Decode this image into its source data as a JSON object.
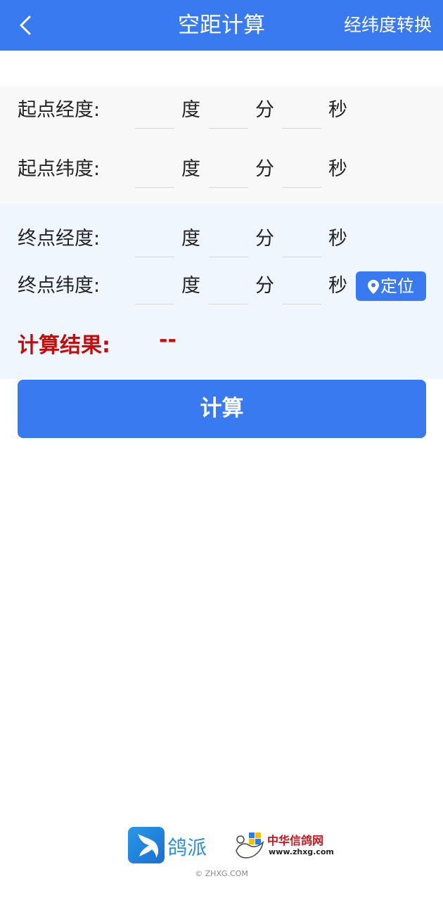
{
  "header": {
    "title": "空距计算",
    "link": "经纬度转换",
    "color": "#3a7af0"
  },
  "units": {
    "degree": "度",
    "minute": "分",
    "second": "秒"
  },
  "start": {
    "longitude_label": "起点经度:",
    "latitude_label": "起点纬度:"
  },
  "end": {
    "longitude_label": "终点经度:",
    "latitude_label": "终点纬度:",
    "locate_label": "定位"
  },
  "result": {
    "label": "计算结果:",
    "value": "--",
    "color": "#c30d0d"
  },
  "calculate_button": "计算",
  "footer": {
    "logo_pigeonpai": "鸽派",
    "logo_zhxg": "中华信鸽网",
    "logo_zhxg_url": "www.zhxg.com",
    "copyright": "© ZHXG.COM"
  }
}
